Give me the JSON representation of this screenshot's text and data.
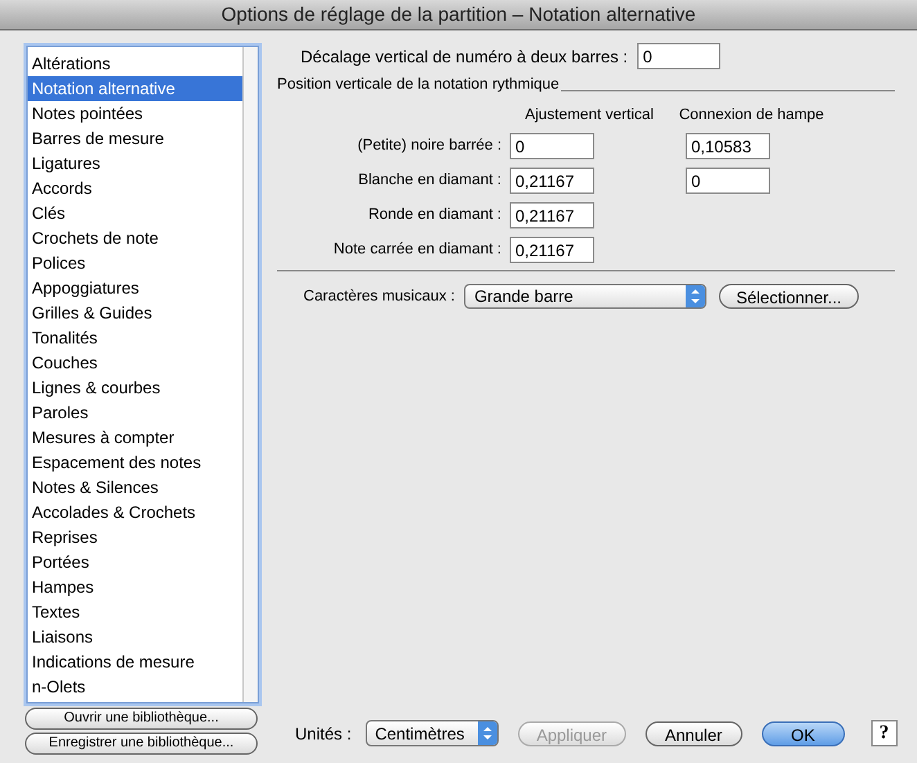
{
  "window": {
    "title": "Options de réglage de la partition – Notation alternative"
  },
  "sidebar": {
    "items": [
      {
        "label": "Altérations",
        "selected": false
      },
      {
        "label": "Notation alternative",
        "selected": true
      },
      {
        "label": "Notes pointées",
        "selected": false
      },
      {
        "label": "Barres de mesure",
        "selected": false
      },
      {
        "label": "Ligatures",
        "selected": false
      },
      {
        "label": "Accords",
        "selected": false
      },
      {
        "label": "Clés",
        "selected": false
      },
      {
        "label": "Crochets de note",
        "selected": false
      },
      {
        "label": "Polices",
        "selected": false
      },
      {
        "label": "Appoggiatures",
        "selected": false
      },
      {
        "label": "Grilles & Guides",
        "selected": false
      },
      {
        "label": "Tonalités",
        "selected": false
      },
      {
        "label": "Couches",
        "selected": false
      },
      {
        "label": "Lignes & courbes",
        "selected": false
      },
      {
        "label": "Paroles",
        "selected": false
      },
      {
        "label": "Mesures à compter",
        "selected": false
      },
      {
        "label": "Espacement des notes",
        "selected": false
      },
      {
        "label": "Notes & Silences",
        "selected": false
      },
      {
        "label": "Accolades & Crochets",
        "selected": false
      },
      {
        "label": "Reprises",
        "selected": false
      },
      {
        "label": "Portées",
        "selected": false
      },
      {
        "label": "Hampes",
        "selected": false
      },
      {
        "label": "Textes",
        "selected": false
      },
      {
        "label": "Liaisons",
        "selected": false
      },
      {
        "label": "Indications de mesure",
        "selected": false
      },
      {
        "label": "n-Olets",
        "selected": false
      }
    ],
    "buttons": [
      "Ouvrir une bibliothèque...",
      "Enregistrer une bibliothèque..."
    ]
  },
  "double_bar_offset": {
    "label": "Décalage vertical de numéro à deux barres :",
    "value": "0"
  },
  "rhythmic_position": {
    "title": "Position verticale de la notation rythmique",
    "columns": [
      "Ajustement vertical",
      "Connexion de hampe"
    ],
    "rows": [
      {
        "label": "(Petite) noire barrée :",
        "vertical": "0",
        "stem": "0,10583"
      },
      {
        "label": "Blanche en diamant :",
        "vertical": "0,21167",
        "stem": "0"
      },
      {
        "label": "Ronde en diamant :",
        "vertical": "0,21167"
      },
      {
        "label": "Note carrée en diamant :",
        "vertical": "0,21167"
      }
    ]
  },
  "music_chars": {
    "label": "Caractères musicaux :",
    "value": "Grande barre",
    "button": "Sélectionner..."
  },
  "footer": {
    "units_label": "Unités :",
    "units_value": "Centimètres",
    "buttons": [
      {
        "label": "Appliquer",
        "kind": "plain",
        "disabled": true
      },
      {
        "label": "Annuler",
        "kind": "plain",
        "disabled": false
      },
      {
        "label": "OK",
        "kind": "default",
        "disabled": false
      }
    ],
    "help": "?"
  }
}
